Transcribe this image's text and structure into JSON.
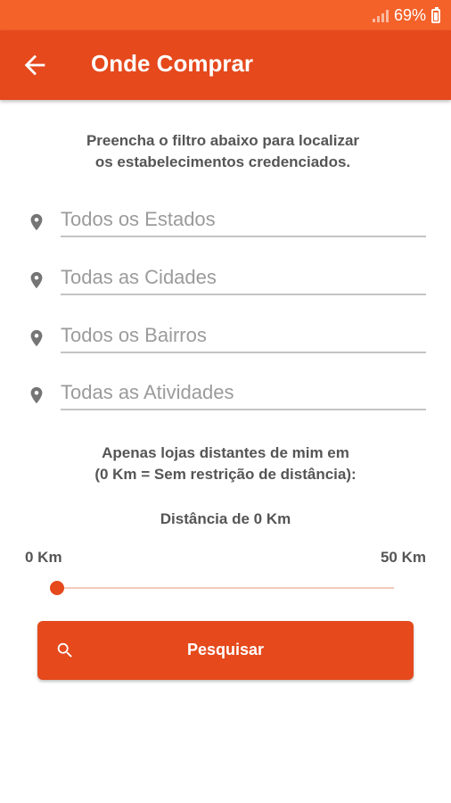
{
  "statusbar": {
    "battery": "69%"
  },
  "appbar": {
    "title": "Onde Comprar",
    "back_icon": "arrow-left-icon"
  },
  "intro": {
    "line1": "Preencha o filtro abaixo para localizar",
    "line2": "os estabelecimentos credenciados."
  },
  "filters": [
    {
      "placeholder": "Todos os Estados",
      "value": "",
      "icon": "location-pin-icon"
    },
    {
      "placeholder": "Todas as Cidades",
      "value": "",
      "icon": "location-pin-icon"
    },
    {
      "placeholder": "Todos os Bairros",
      "value": "",
      "icon": "location-pin-icon"
    },
    {
      "placeholder": "Todas as Atividades",
      "value": "",
      "icon": "location-pin-icon"
    }
  ],
  "distance": {
    "info_line1": "Apenas lojas distantes de mim em",
    "info_line2": "(0 Km = Sem restrição de distância):",
    "current_label": "Distância de 0 Km",
    "min_label": "0 Km",
    "max_label": "50 Km",
    "value": 0,
    "min": 0,
    "max": 50
  },
  "search_button": {
    "label": "Pesquisar",
    "icon": "search-icon"
  },
  "colors": {
    "primary": "#e5491c",
    "statusbar": "#f4622a",
    "track": "#f3c9ba"
  }
}
